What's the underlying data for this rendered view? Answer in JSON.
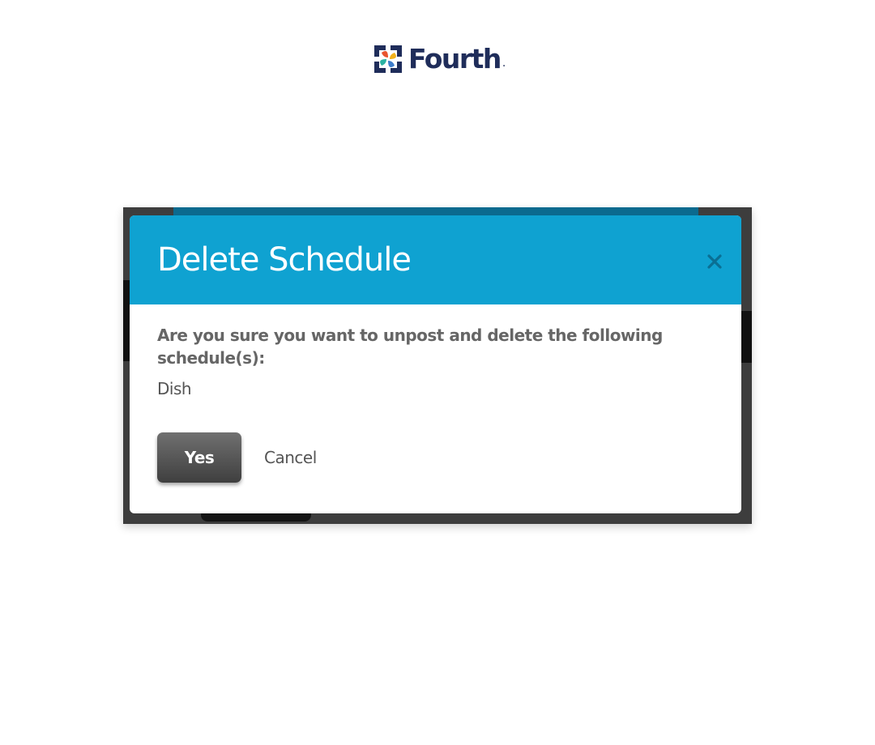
{
  "logo": {
    "brand_name": "Fourth",
    "trademark_dot": ".",
    "icon": "fourth-logo-mark",
    "brand_color": "#1f2d5a"
  },
  "dialog": {
    "title": "Delete Schedule",
    "close_icon": "close-icon",
    "header_color": "#0fa2d1",
    "message": "Are you sure you want to unpost and delete the following schedule(s):",
    "schedules": [
      "Dish"
    ],
    "buttons": {
      "yes_label": "Yes",
      "cancel_label": "Cancel"
    }
  }
}
